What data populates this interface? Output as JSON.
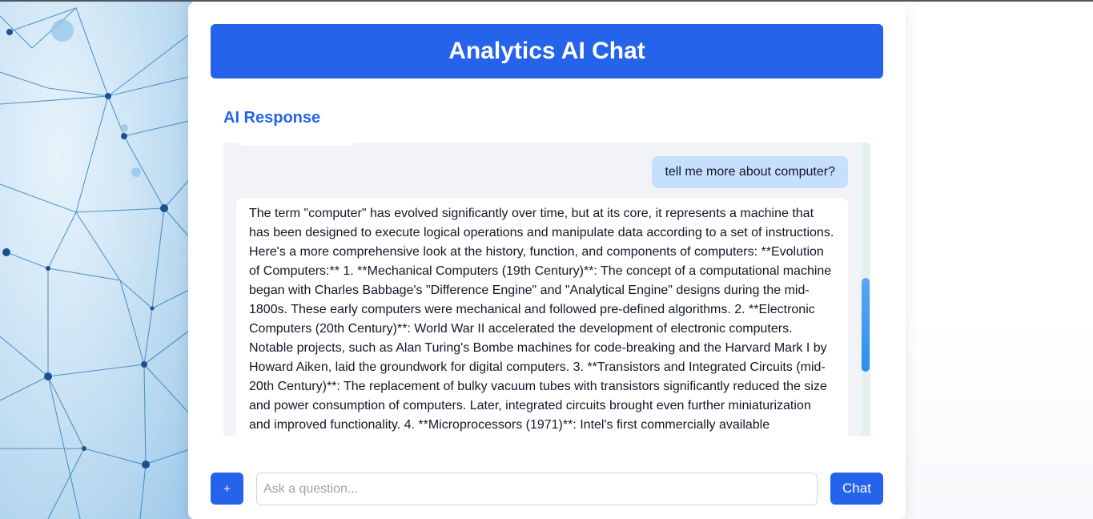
{
  "app": {
    "title": "Analytics AI Chat"
  },
  "response_section": {
    "title": "AI Response"
  },
  "messages": [
    {
      "role": "user",
      "text": "tell me more about computer?"
    },
    {
      "role": "assistant",
      "text": "The term \"computer\" has evolved significantly over time, but at its core, it represents a machine that has been designed to execute logical operations and manipulate data according to a set of instructions. Here's a more comprehensive look at the history, function, and components of computers: **Evolution of Computers:** 1. **Mechanical Computers (19th Century)**: The concept of a computational machine began with Charles Babbage's \"Difference Engine\" and \"Analytical Engine\" designs during the mid-1800s. These early computers were mechanical and followed pre-defined algorithms. 2. **Electronic Computers (20th Century)**: World War II accelerated the development of electronic computers. Notable projects, such as Alan Turing's Bombe machines for code-breaking and the Harvard Mark I by Howard Aiken, laid the groundwork for digital computers. 3. **Transistors and Integrated Circuits (mid-20th Century)**: The replacement of bulky vacuum tubes with transistors significantly reduced the size and power consumption of computers. Later, integrated circuits brought even further miniaturization and improved functionality. 4. **Microprocessors (1971)**: Intel's first commercially available"
    }
  ],
  "input": {
    "plus_label": "+",
    "placeholder": "Ask a question...",
    "value": "",
    "send_label": "Chat"
  },
  "colors": {
    "primary": "#2563eb",
    "user_bubble": "#c5dffd",
    "chat_background": "#f1f3f6"
  }
}
